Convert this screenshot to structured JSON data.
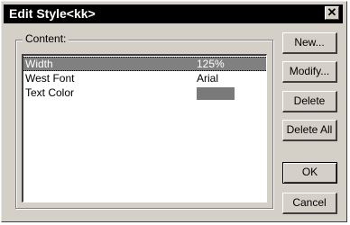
{
  "window": {
    "title": "Edit Style<kk>",
    "close_glyph": "✕"
  },
  "group": {
    "label": "Content:"
  },
  "list": {
    "rows": [
      {
        "name": "Width",
        "value": "125%",
        "selected": true
      },
      {
        "name": "West Font",
        "value": "Arial",
        "selected": false
      },
      {
        "name": "Text Color",
        "value": "",
        "swatch_color": "#7a7a7a",
        "selected": false
      }
    ]
  },
  "buttons": {
    "new_label": "New...",
    "modify_label": "Modify...",
    "delete_label": "Delete",
    "delete_all_label": "Delete All",
    "ok_label": "OK",
    "cancel_label": "Cancel"
  },
  "colors": {
    "face": "#d4d0c8",
    "title_bar": "#000000",
    "selection": "#808080"
  }
}
